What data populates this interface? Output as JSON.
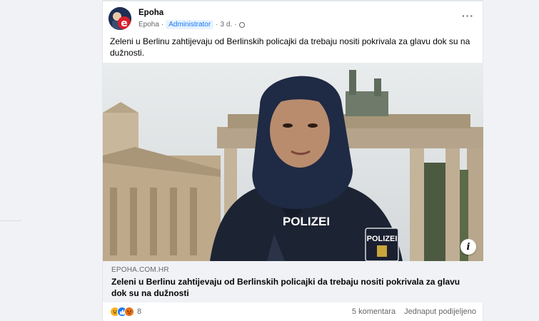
{
  "post": {
    "page_name": "Epoha",
    "meta_name": "Epoha",
    "role_badge": "Administrator",
    "time": "3 d.",
    "separator": "·",
    "more": "···",
    "text": "Zeleni u Berlinu zahtijevaju od Berlinskih policajki da trebaju nositi pokrivala za glavu dok su na dužnosti.",
    "image_text": "POLIZEI",
    "image_patch_text": "POLIZEI",
    "info_icon": "i"
  },
  "link": {
    "domain": "EPOHA.COM.HR",
    "title": "Zeleni u Berlinu zahtijevaju od Berlinskih policajki da trebaju nositi pokrivala za glavu dok su na dužnosti"
  },
  "footer": {
    "reactions": [
      "haha",
      "like",
      "angry"
    ],
    "reaction_count": "8",
    "comments": "5 komentara",
    "shares": "Jednaput podijeljeno"
  },
  "colors": {
    "accent": "#1877f2",
    "muted_text": "#65676b",
    "background": "#f0f2f5"
  }
}
